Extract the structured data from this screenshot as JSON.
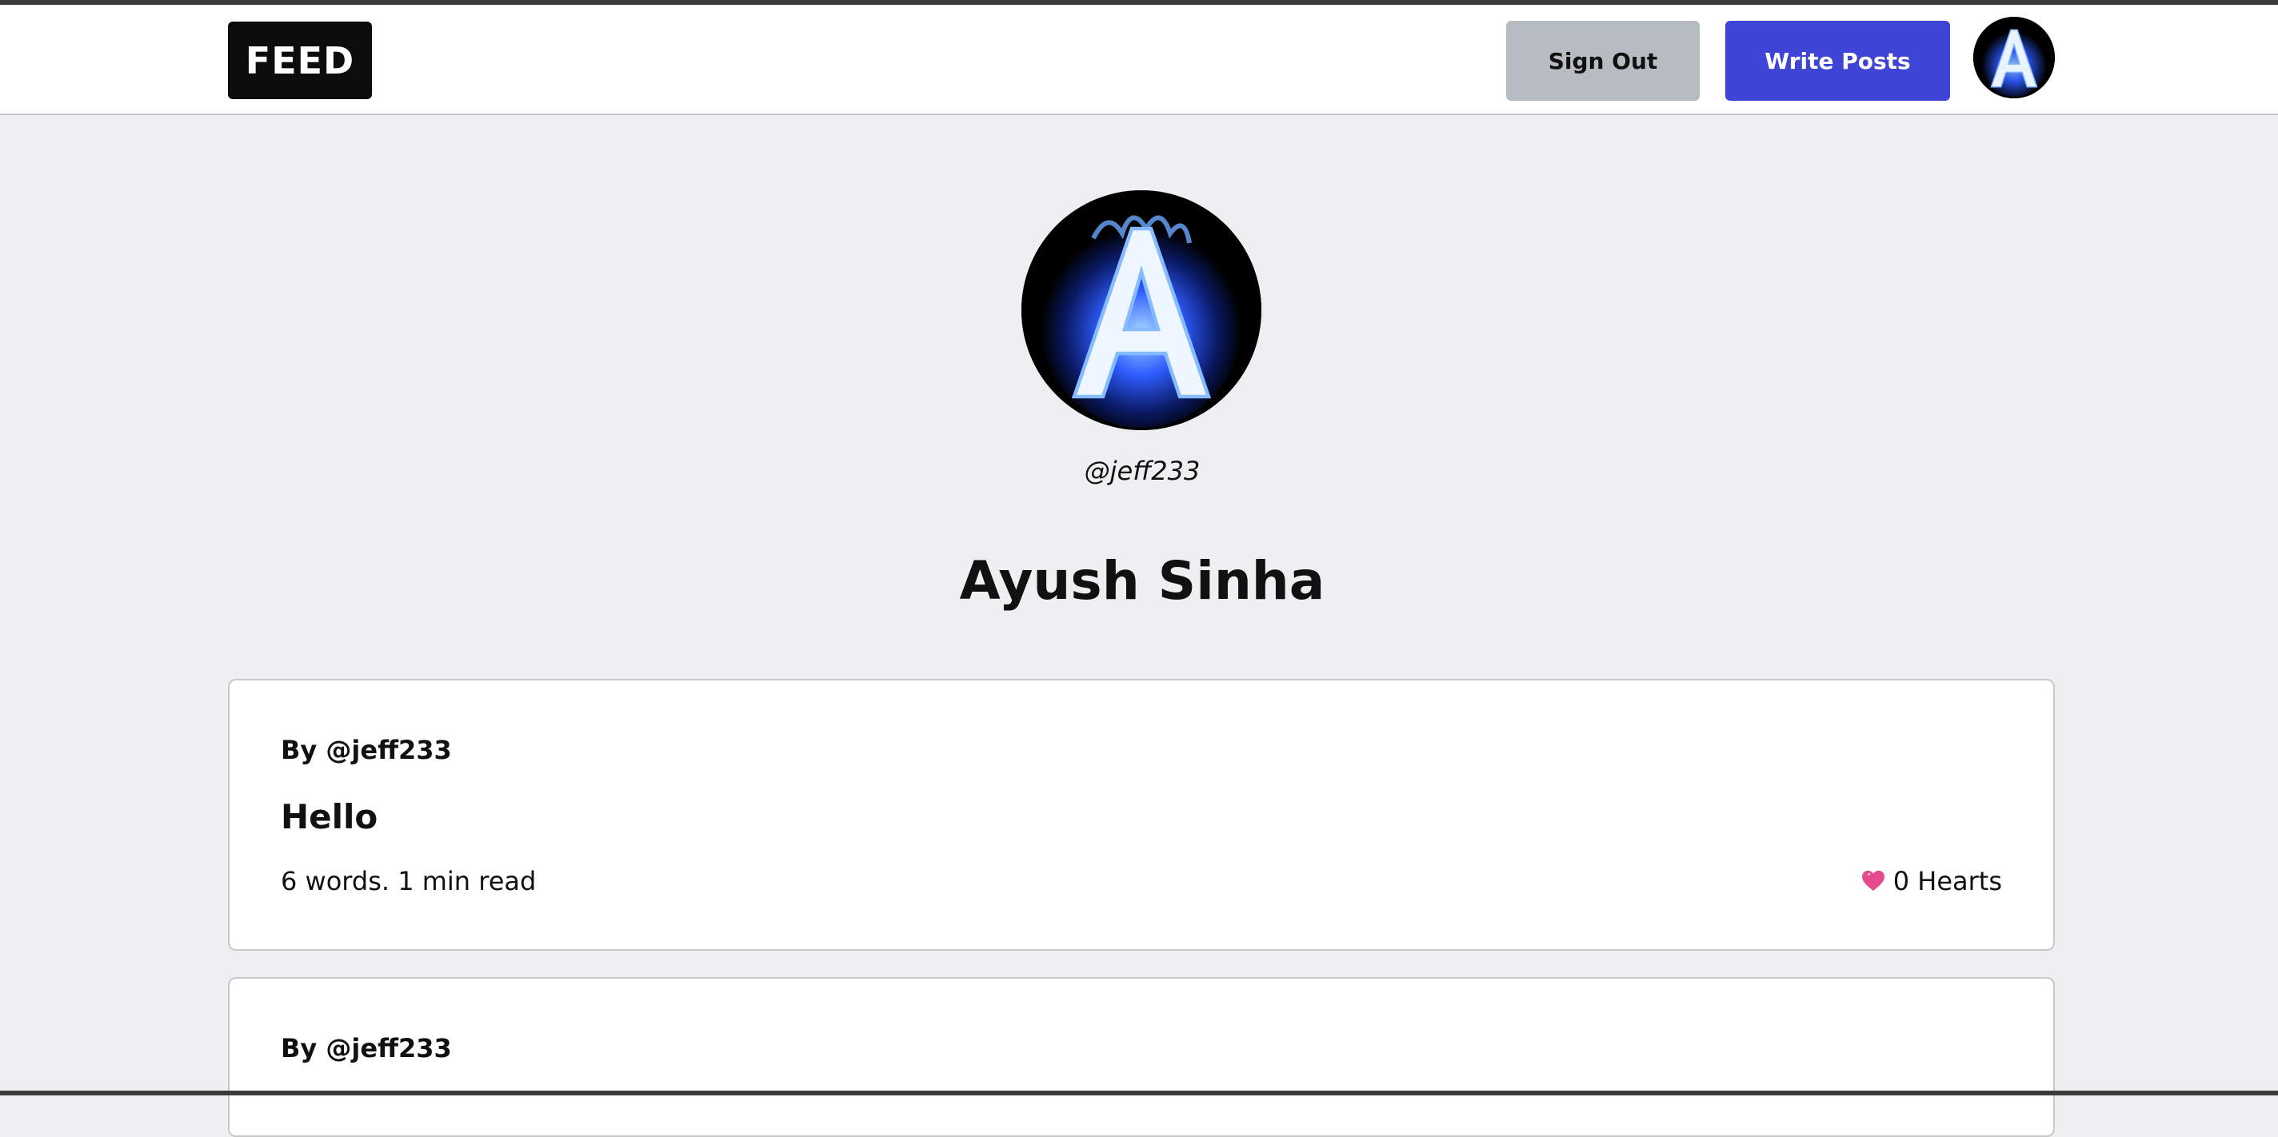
{
  "header": {
    "logo_label": "FEED",
    "sign_out_label": "Sign Out",
    "write_posts_label": "Write Posts"
  },
  "profile": {
    "username": "@jeff233",
    "display_name": "Ayush Sinha",
    "avatar_letter": "A"
  },
  "posts": [
    {
      "author": "By @jeff233",
      "title": "Hello",
      "meta": "6 words. 1 min read",
      "hearts": "0 Hearts"
    },
    {
      "author": "By @jeff233"
    }
  ],
  "colors": {
    "accent": "#3d44d6",
    "secondary_button": "#b7bcc2",
    "background": "#eeeff1",
    "heart": "#e64a8f"
  }
}
